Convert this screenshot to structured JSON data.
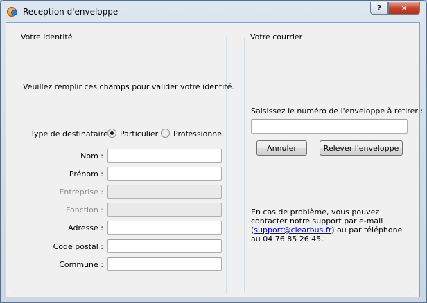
{
  "window": {
    "title": "Reception d'enveloppe",
    "help_label": "?",
    "close_label": "✕",
    "icon": "app-logo-icon"
  },
  "identity": {
    "legend": "Votre identité",
    "instruction": "Veuillez remplir ces champs pour valider votre identité.",
    "recipient_type_label": "Type de destinataire :",
    "radio_particulier": "Particulier",
    "radio_professionnel": "Professionnel",
    "selected_type": "Particulier",
    "fields": [
      {
        "label": "Nom :",
        "value": "",
        "enabled": true
      },
      {
        "label": "Prénom :",
        "value": "",
        "enabled": true
      },
      {
        "label": "Entreprise :",
        "value": "",
        "enabled": false
      },
      {
        "label": "Fonction :",
        "value": "",
        "enabled": false
      },
      {
        "label": "Adresse :",
        "value": "",
        "enabled": true
      },
      {
        "label": "Code postal :",
        "value": "",
        "enabled": true
      },
      {
        "label": "Commune :",
        "value": "",
        "enabled": true
      }
    ]
  },
  "mail": {
    "legend": "Votre courrier",
    "prompt": "Saisissez le numéro de l'enveloppe à retirer :",
    "envelope_number": "",
    "cancel_label": "Annuler",
    "retrieve_label": "Relever l'enveloppe",
    "support_text_before": "En cas de problème, vous pouvez contacter notre support par e-mail (",
    "support_email": "support@clearbus.fr",
    "support_text_after": ") ou par téléphone au 04 76 85 26 45."
  }
}
